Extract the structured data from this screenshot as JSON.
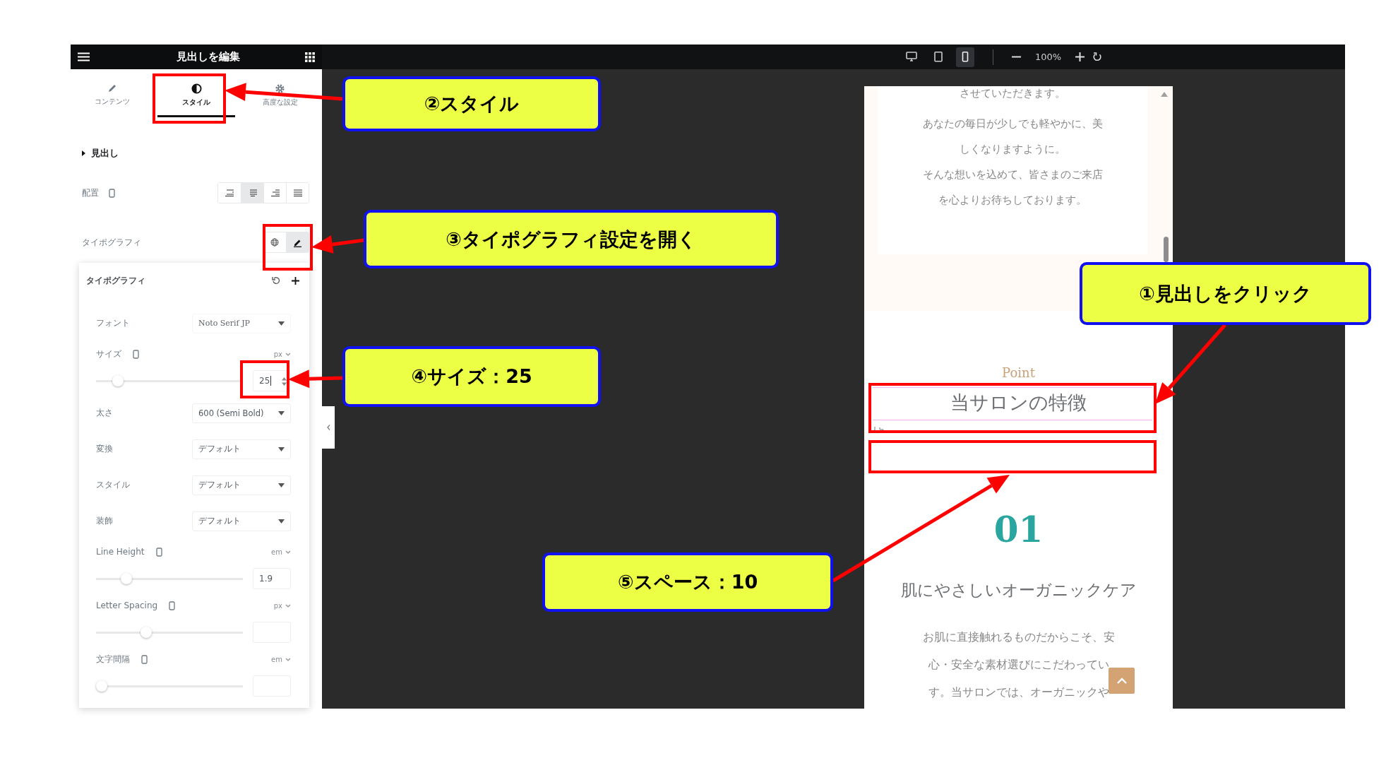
{
  "panel_header": {
    "title": "見出しを編集"
  },
  "tabs": [
    {
      "label": "コンテンツ",
      "selected": false
    },
    {
      "label": "スタイル",
      "selected": true
    },
    {
      "label": "高度な設定",
      "selected": false
    }
  ],
  "section": {
    "title": "見出し"
  },
  "alignment": {
    "label": "配置",
    "options": [
      {
        "selected": false
      },
      {
        "selected": true
      },
      {
        "selected": false
      },
      {
        "selected": false
      }
    ]
  },
  "typography": {
    "label": "タイポグラフィ",
    "buttons": [
      {
        "selected": false
      },
      {
        "selected": true
      }
    ]
  },
  "typography_popover": {
    "title": "タイポグラフィ",
    "fields": [
      {
        "kind": "font",
        "label": "フォント",
        "value": "Noto Serif JP"
      },
      {
        "kind": "slider",
        "label": "サイズ",
        "unit": "px",
        "level": 0.12,
        "value": "25"
      },
      {
        "kind": "select",
        "label": "太さ",
        "value": "600 (Semi Bold)"
      },
      {
        "kind": "select",
        "label": "変換",
        "value": "デフォルト"
      },
      {
        "kind": "select",
        "label": "スタイル",
        "value": "デフォルト"
      },
      {
        "kind": "select",
        "label": "装飾",
        "value": "デフォルト"
      },
      {
        "kind": "slider",
        "label": "Line Height",
        "unit": "em",
        "level": 0.18,
        "value": "1.9"
      },
      {
        "kind": "slider",
        "label": "Letter Spacing",
        "unit": "px",
        "level": 0.33
      },
      {
        "kind": "slider",
        "label": "文字間隔",
        "unit": "em",
        "level": 0
      }
    ]
  },
  "canvas_toolbar": {
    "devices": [
      {
        "selected": false
      },
      {
        "selected": false
      },
      {
        "selected": true
      }
    ],
    "zoom": "100%"
  },
  "preview": {
    "intro_lines": [
      "させていただきます。",
      "あなたの毎日が少しでも軽やかに、美",
      "しくなりますように。",
      "そんな想いを込めて、皆さまのご来店",
      "を心よりお待ちしております。"
    ],
    "eyebrow": "Point",
    "heading": "当サロンの特徴",
    "number": "01",
    "subheading": "肌にやさしいオーガニックケア",
    "body_lines": [
      "お肌に直接触れるものだからこそ、安",
      "心・安全な素材選びにこだわってい",
      "す。当サロンでは、オーガニックや"
    ]
  },
  "callouts": [
    {
      "text": "②スタイル"
    },
    {
      "text": "③タイポグラフィ設定を開く"
    },
    {
      "text": "①見出しをクリック"
    },
    {
      "text": "④サイズ：25"
    },
    {
      "text": "⑤スペース：10"
    }
  ]
}
